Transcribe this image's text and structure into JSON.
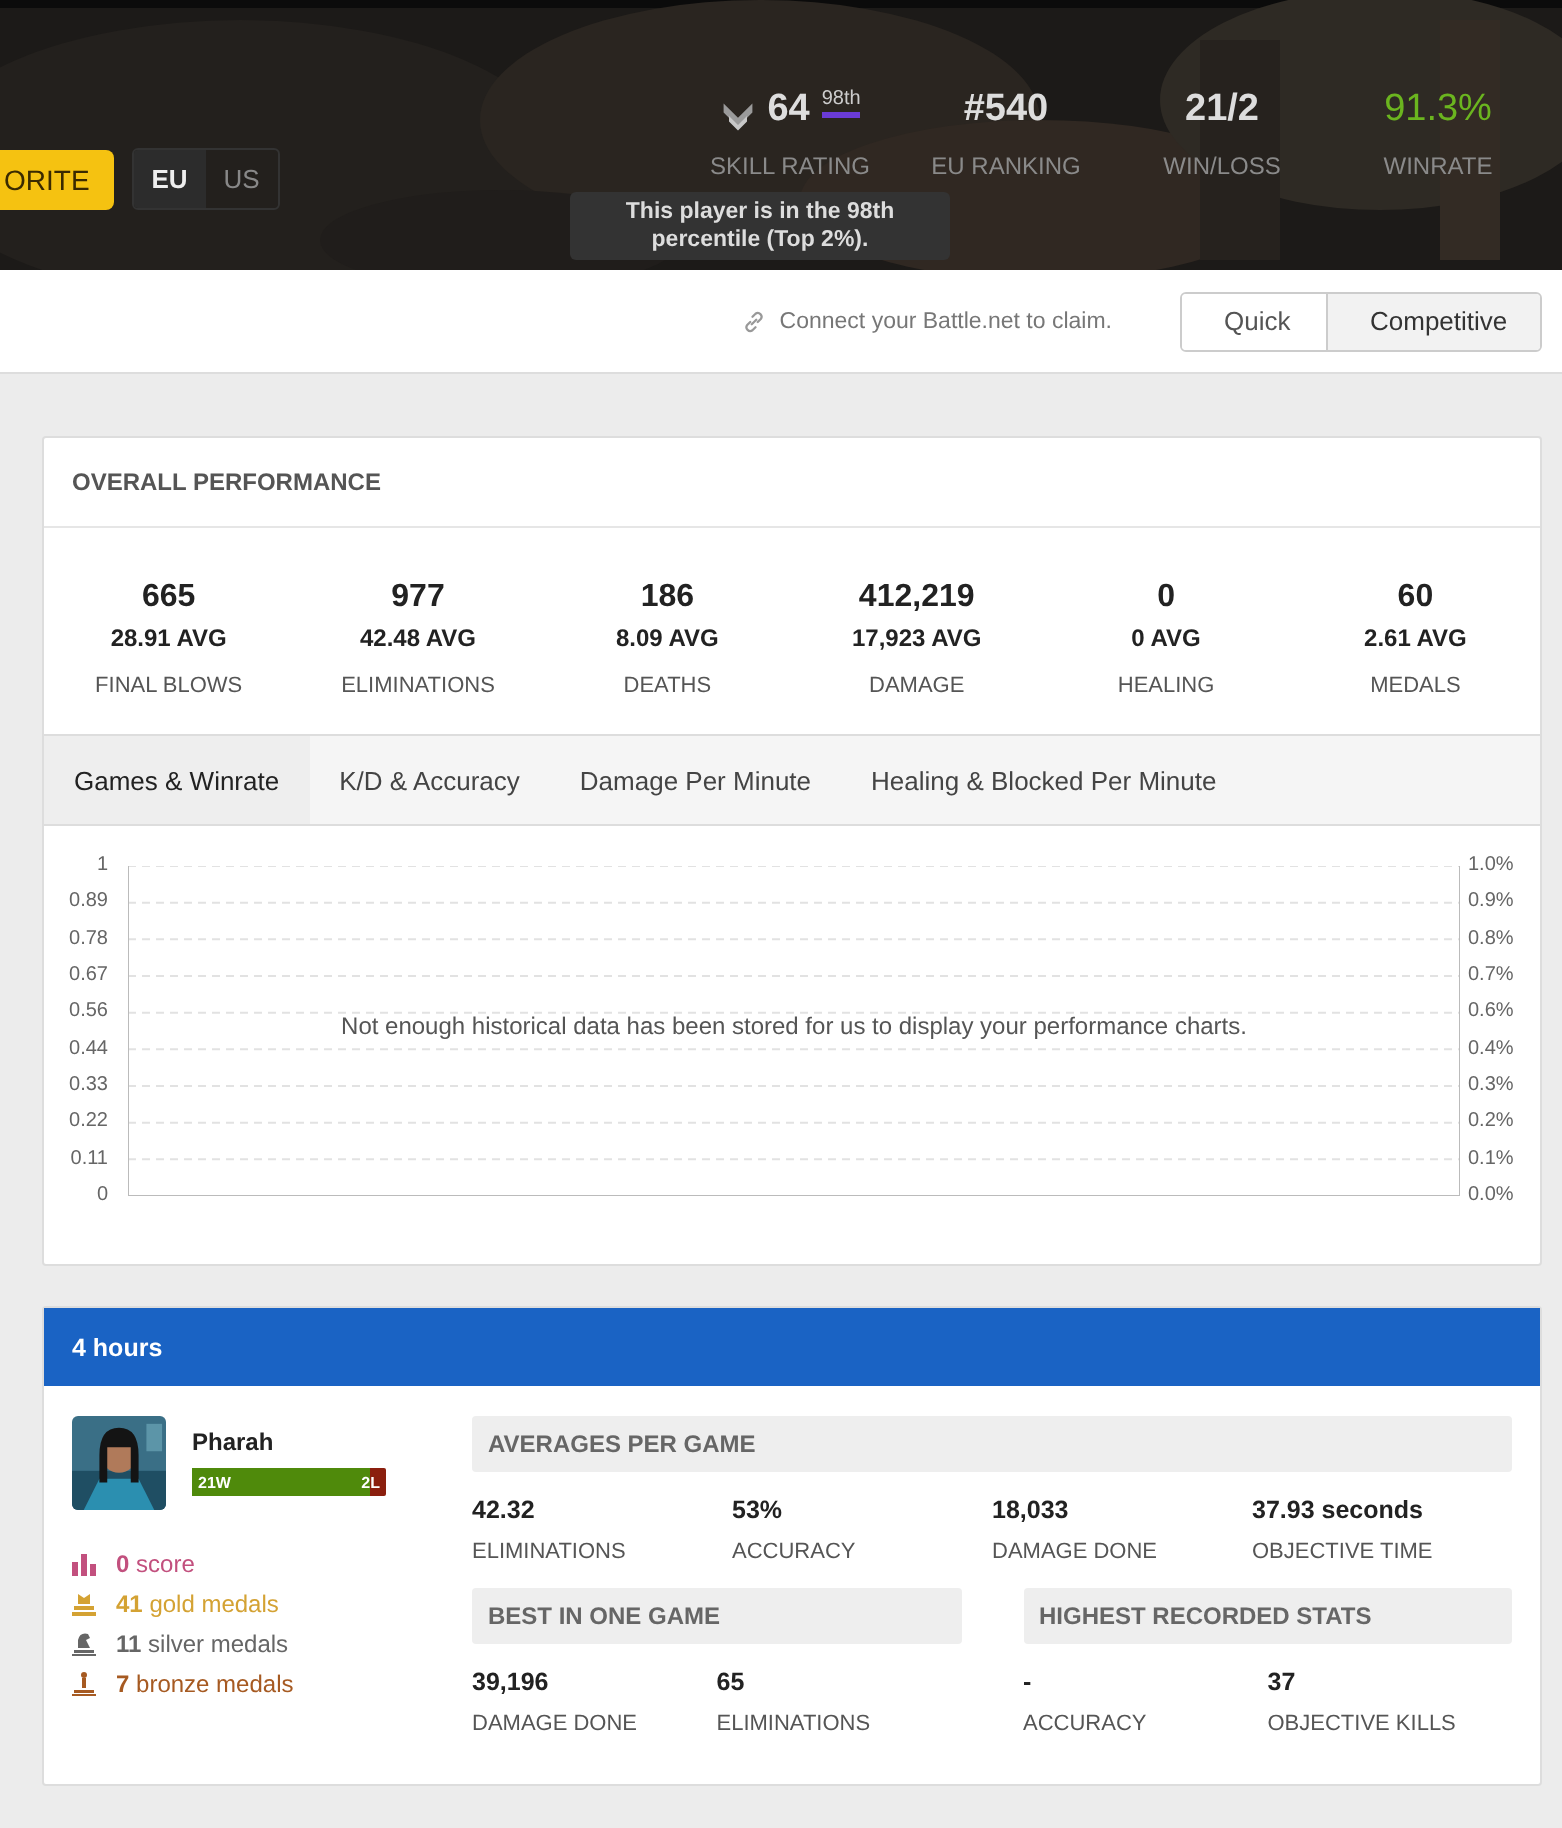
{
  "header": {
    "favorite_button": "ORITE",
    "regions": [
      {
        "label": "EU",
        "selected": true
      },
      {
        "label": "US",
        "selected": false
      }
    ],
    "stats": [
      {
        "kind": "rating",
        "value": "64",
        "percentile": "98th",
        "label": "SKILL RATING",
        "highlight": false
      },
      {
        "kind": "plain",
        "value": "#540",
        "label": "EU RANKING",
        "highlight": false
      },
      {
        "kind": "plain",
        "value": "21/2",
        "label": "WIN/LOSS",
        "highlight": false
      },
      {
        "kind": "plain",
        "value": "91.3%",
        "label": "WINRATE",
        "highlight": true
      }
    ],
    "tooltip": "This player is in the 98th percentile (Top 2%)."
  },
  "claim_bar": {
    "text": "Connect your Battle.net to claim.",
    "modes": [
      {
        "label": "Quick",
        "selected": false
      },
      {
        "label": "Competitive",
        "selected": true
      }
    ]
  },
  "overall": {
    "title": "OVERALL PERFORMANCE",
    "stats": [
      {
        "value": "665",
        "avg": "28.91 AVG",
        "label": "FINAL BLOWS"
      },
      {
        "value": "977",
        "avg": "42.48 AVG",
        "label": "ELIMINATIONS"
      },
      {
        "value": "186",
        "avg": "8.09 AVG",
        "label": "DEATHS"
      },
      {
        "value": "412,219",
        "avg": "17,923 AVG",
        "label": "DAMAGE"
      },
      {
        "value": "0",
        "avg": "0 AVG",
        "label": "HEALING"
      },
      {
        "value": "60",
        "avg": "2.61 AVG",
        "label": "MEDALS"
      }
    ],
    "tabs": [
      {
        "label": "Games & Winrate",
        "selected": true
      },
      {
        "label": "K/D & Accuracy",
        "selected": false
      },
      {
        "label": "Damage Per Minute",
        "selected": false
      },
      {
        "label": "Healing & Blocked Per Minute",
        "selected": false
      }
    ],
    "chart": {
      "left_ticks": [
        "1",
        "0.89",
        "0.78",
        "0.67",
        "0.56",
        "0.44",
        "0.33",
        "0.22",
        "0.11",
        "0"
      ],
      "right_ticks": [
        "1.0%",
        "0.9%",
        "0.8%",
        "0.7%",
        "0.6%",
        "0.4%",
        "0.3%",
        "0.2%",
        "0.1%",
        "0.0%"
      ],
      "message": "Not enough historical data has been stored for us to display your performance charts."
    }
  },
  "session": {
    "title": "4 hours",
    "hero": {
      "name": "Pharah",
      "wins": "21W",
      "losses": "2L",
      "level": 0.913
    },
    "medals": [
      {
        "kind": "score",
        "count": "0",
        "label": "score",
        "color": "#c2507e"
      },
      {
        "kind": "gold",
        "count": "41",
        "label": "gold medals",
        "color": "#d4a233"
      },
      {
        "kind": "silver",
        "count": "11",
        "label": "silver medals",
        "color": "#666666"
      },
      {
        "kind": "bronze",
        "count": "7",
        "label": "bronze medals",
        "color": "#a65a22"
      }
    ],
    "averages": {
      "title": "AVERAGES PER GAME",
      "stats": [
        {
          "value": "42.32",
          "label": "ELIMINATIONS"
        },
        {
          "value": "53%",
          "label": "ACCURACY"
        },
        {
          "value": "18,033",
          "label": "DAMAGE DONE"
        },
        {
          "value": "37.93 seconds",
          "label": "OBJECTIVE TIME"
        }
      ]
    },
    "best": {
      "title": "BEST IN ONE GAME",
      "stats": [
        {
          "value": "39,196",
          "label": "DAMAGE DONE"
        },
        {
          "value": "65",
          "label": "ELIMINATIONS"
        }
      ]
    },
    "highest": {
      "title": "HIGHEST RECORDED STATS",
      "stats": [
        {
          "value": "-",
          "label": "ACCURACY"
        },
        {
          "value": "37",
          "label": "OBJECTIVE KILLS"
        }
      ]
    }
  }
}
